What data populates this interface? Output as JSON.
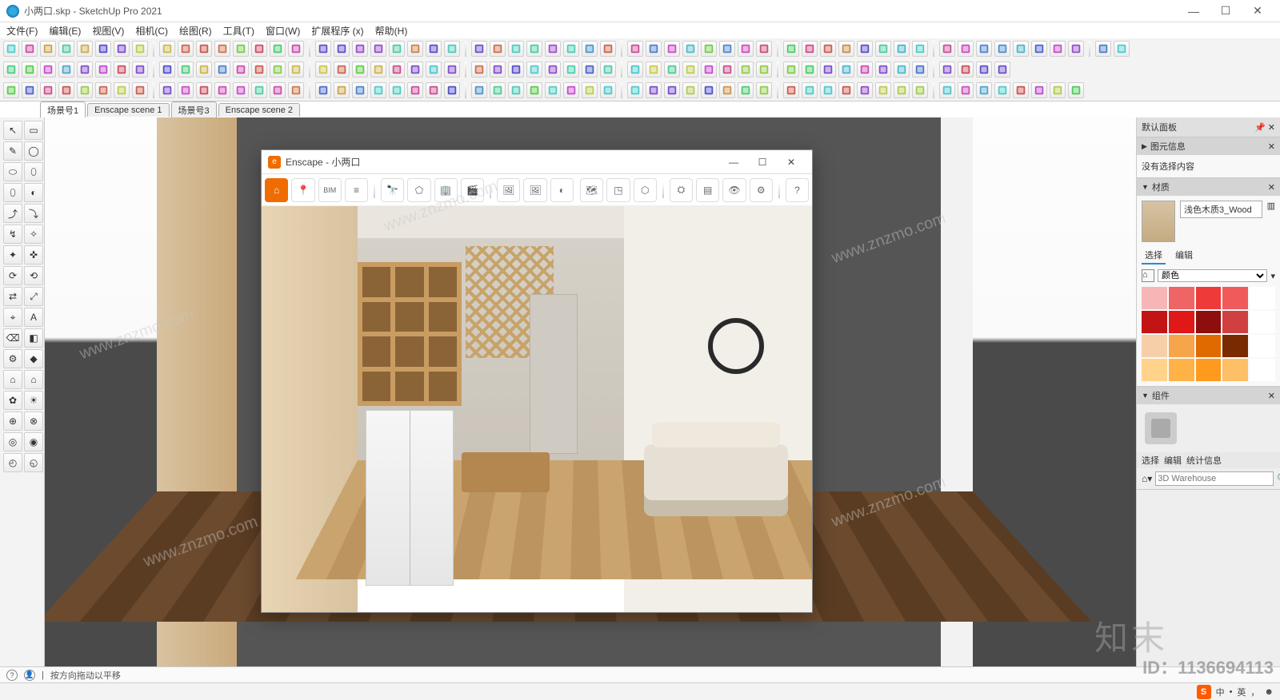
{
  "window": {
    "title": "小两口.skp - SketchUp Pro 2021",
    "min": "—",
    "max": "☐",
    "close": "✕"
  },
  "menu": [
    "文件(F)",
    "编辑(E)",
    "视图(V)",
    "相机(C)",
    "绘图(R)",
    "工具(T)",
    "窗口(W)",
    "扩展程序 (x)",
    "帮助(H)"
  ],
  "scenes": [
    "场景号1",
    "Enscape scene 1",
    "场景号3",
    "Enscape scene 2"
  ],
  "enscape": {
    "title": "Enscape - 小两口",
    "min": "—",
    "max": "☐",
    "close": "✕",
    "bim_label": "BIM"
  },
  "tray": {
    "header": "默认面板",
    "entity_title": "图元信息",
    "entity_body": "没有选择内容",
    "material_title": "材质",
    "material_name": "浅色木质3_Wood",
    "tab_select": "选择",
    "tab_edit": "编辑",
    "color_mode": "颜色",
    "component_title": "组件",
    "comp_tab1": "选择",
    "comp_tab2": "编辑",
    "comp_tab3": "统计信息",
    "wh_placeholder": "3D Warehouse"
  },
  "swatch_colors": [
    "#f7b6b6",
    "#ef6464",
    "#ef3a3a",
    "#f05a5a",
    "#ffffff",
    "#c21414",
    "#e01818",
    "#8e0d0d",
    "#d04040",
    "#ffffff",
    "#f6cfa9",
    "#f7a54a",
    "#e06a00",
    "#7a2a00",
    "#ffffff",
    "#ffd38a",
    "#ffb347",
    "#ff9a1f",
    "#ffbf66",
    "#ffffff"
  ],
  "status": {
    "hint": "按方向拖动以平移"
  },
  "taskbar": {
    "ime": "中",
    "lang": "英",
    "dot": "•",
    "punc": "，",
    "emoji": "☻"
  },
  "watermark": {
    "text": "www.znzmo.com",
    "logo": "知末",
    "id": "ID：1136694113"
  }
}
